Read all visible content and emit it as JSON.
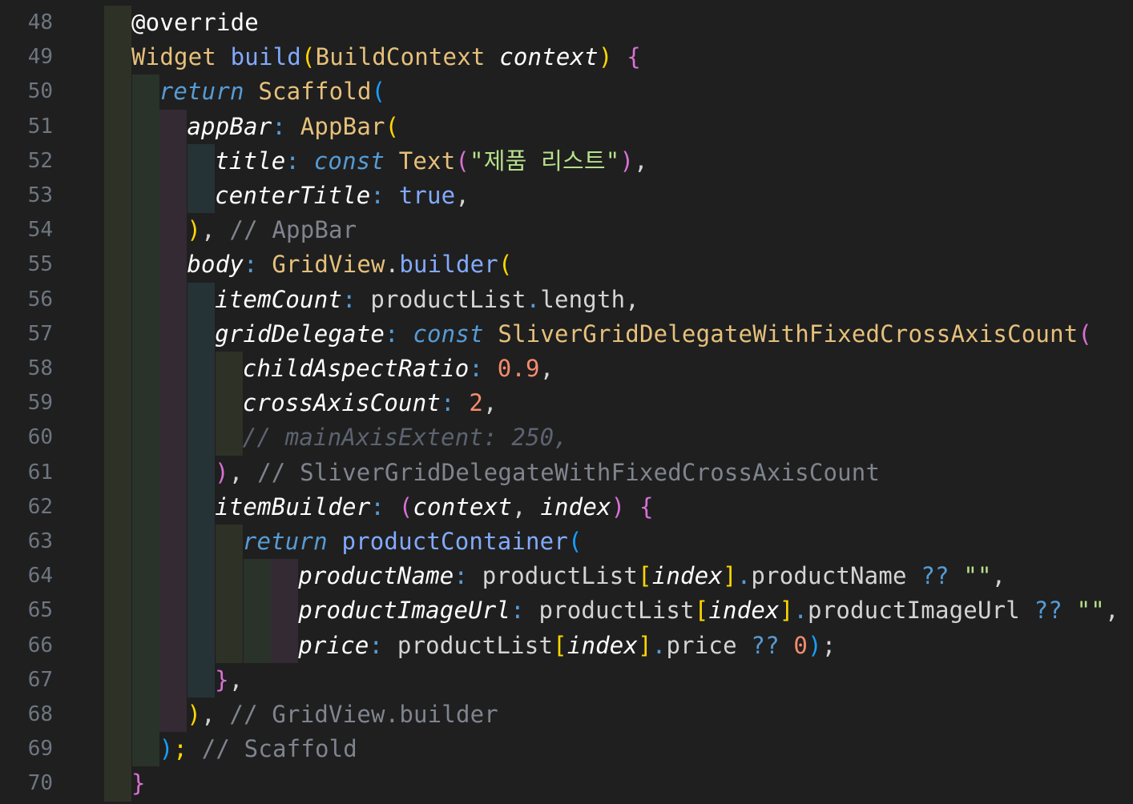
{
  "colors": {
    "background": "#1f1f1f",
    "line_number": "#6e7681",
    "default": "#d4d4d4",
    "keyword_ctrl": "#569cd6",
    "type": "#e6c07b",
    "function": "#82aaff",
    "param": "#ffffff",
    "string": "#b5e08a",
    "number": "#f78c6c",
    "comment": "#7f848e",
    "bracket_yellow": "#ffd700",
    "bracket_pink": "#da70d6",
    "bracket_blue": "#179fff",
    "decorator": "#ffffff"
  },
  "lines": [
    {
      "num": "48",
      "tokens": [
        {
          "t": "@override",
          "c": "decorator"
        }
      ]
    },
    {
      "num": "49",
      "tokens": [
        {
          "t": "Widget",
          "c": "type"
        },
        {
          "t": " "
        },
        {
          "t": "build",
          "c": "function"
        },
        {
          "t": "(",
          "c": "bracket_yellow"
        },
        {
          "t": "BuildContext",
          "c": "type"
        },
        {
          "t": " "
        },
        {
          "t": "context",
          "c": "param",
          "i": true
        },
        {
          "t": ")",
          "c": "bracket_yellow"
        },
        {
          "t": " "
        },
        {
          "t": "{",
          "c": "bracket_pink"
        }
      ]
    },
    {
      "num": "50",
      "tokens": [
        {
          "t": "return",
          "c": "keyword_ctrl",
          "i": true
        },
        {
          "t": " "
        },
        {
          "t": "Scaffold",
          "c": "type"
        },
        {
          "t": "(",
          "c": "bracket_blue"
        }
      ]
    },
    {
      "num": "51",
      "tokens": [
        {
          "t": "appBar",
          "c": "param",
          "i": true
        },
        {
          "t": ":",
          "c": "keyword_ctrl"
        },
        {
          "t": " "
        },
        {
          "t": "AppBar",
          "c": "type"
        },
        {
          "t": "(",
          "c": "bracket_yellow"
        }
      ]
    },
    {
      "num": "52",
      "tokens": [
        {
          "t": "title",
          "c": "param",
          "i": true
        },
        {
          "t": ":",
          "c": "keyword_ctrl"
        },
        {
          "t": " "
        },
        {
          "t": "const",
          "c": "keyword_ctrl",
          "i": true
        },
        {
          "t": " "
        },
        {
          "t": "Text",
          "c": "type"
        },
        {
          "t": "(",
          "c": "bracket_pink"
        },
        {
          "t": "\"제품 리스트\"",
          "c": "string"
        },
        {
          "t": ")",
          "c": "bracket_pink"
        },
        {
          "t": ",",
          "c": "default"
        }
      ]
    },
    {
      "num": "53",
      "tokens": [
        {
          "t": "centerTitle",
          "c": "param",
          "i": true
        },
        {
          "t": ":",
          "c": "keyword_ctrl"
        },
        {
          "t": " "
        },
        {
          "t": "true",
          "c": "function"
        },
        {
          "t": ",",
          "c": "default"
        }
      ]
    },
    {
      "num": "54",
      "tokens": [
        {
          "t": ")",
          "c": "bracket_yellow"
        },
        {
          "t": ",",
          "c": "default"
        },
        {
          "t": " "
        },
        {
          "t": "// AppBar",
          "c": "comment"
        }
      ]
    },
    {
      "num": "55",
      "tokens": [
        {
          "t": "body",
          "c": "param",
          "i": true
        },
        {
          "t": ":",
          "c": "keyword_ctrl"
        },
        {
          "t": " "
        },
        {
          "t": "GridView",
          "c": "type"
        },
        {
          "t": ".",
          "c": "default"
        },
        {
          "t": "builder",
          "c": "function"
        },
        {
          "t": "(",
          "c": "bracket_yellow"
        }
      ]
    },
    {
      "num": "56",
      "tokens": [
        {
          "t": "itemCount",
          "c": "param",
          "i": true
        },
        {
          "t": ":",
          "c": "keyword_ctrl"
        },
        {
          "t": " "
        },
        {
          "t": "productList",
          "c": "default"
        },
        {
          "t": ".",
          "c": "keyword_ctrl"
        },
        {
          "t": "length",
          "c": "default"
        },
        {
          "t": ",",
          "c": "default"
        }
      ]
    },
    {
      "num": "57",
      "tokens": [
        {
          "t": "gridDelegate",
          "c": "param",
          "i": true
        },
        {
          "t": ":",
          "c": "keyword_ctrl"
        },
        {
          "t": " "
        },
        {
          "t": "const",
          "c": "keyword_ctrl",
          "i": true
        },
        {
          "t": " "
        },
        {
          "t": "SliverGridDelegateWithFixedCrossAxisCount",
          "c": "type"
        },
        {
          "t": "(",
          "c": "bracket_pink"
        }
      ]
    },
    {
      "num": "58",
      "tokens": [
        {
          "t": "childAspectRatio",
          "c": "param",
          "i": true
        },
        {
          "t": ":",
          "c": "keyword_ctrl"
        },
        {
          "t": " "
        },
        {
          "t": "0.9",
          "c": "number"
        },
        {
          "t": ",",
          "c": "default"
        }
      ]
    },
    {
      "num": "59",
      "tokens": [
        {
          "t": "crossAxisCount",
          "c": "param",
          "i": true
        },
        {
          "t": ":",
          "c": "keyword_ctrl"
        },
        {
          "t": " "
        },
        {
          "t": "2",
          "c": "number"
        },
        {
          "t": ",",
          "c": "default"
        }
      ]
    },
    {
      "num": "60",
      "tokens": [
        {
          "t": "// mainAxisExtent: 250,",
          "c": "comment_dim",
          "i": true
        }
      ]
    },
    {
      "num": "61",
      "tokens": [
        {
          "t": ")",
          "c": "bracket_pink"
        },
        {
          "t": ",",
          "c": "default"
        },
        {
          "t": " "
        },
        {
          "t": "// SliverGridDelegateWithFixedCrossAxisCount",
          "c": "comment"
        }
      ]
    },
    {
      "num": "62",
      "tokens": [
        {
          "t": "itemBuilder",
          "c": "param",
          "i": true
        },
        {
          "t": ":",
          "c": "keyword_ctrl"
        },
        {
          "t": " "
        },
        {
          "t": "(",
          "c": "bracket_pink"
        },
        {
          "t": "context",
          "c": "param",
          "i": true
        },
        {
          "t": ",",
          "c": "default"
        },
        {
          "t": " "
        },
        {
          "t": "index",
          "c": "param",
          "i": true
        },
        {
          "t": ")",
          "c": "bracket_pink"
        },
        {
          "t": " "
        },
        {
          "t": "{",
          "c": "bracket_pink"
        }
      ]
    },
    {
      "num": "63",
      "tokens": [
        {
          "t": "return",
          "c": "keyword_ctrl",
          "i": true
        },
        {
          "t": " "
        },
        {
          "t": "productContainer",
          "c": "function"
        },
        {
          "t": "(",
          "c": "bracket_blue"
        }
      ]
    },
    {
      "num": "64",
      "tokens": [
        {
          "t": "productName",
          "c": "param",
          "i": true
        },
        {
          "t": ":",
          "c": "keyword_ctrl"
        },
        {
          "t": " "
        },
        {
          "t": "productList",
          "c": "default"
        },
        {
          "t": "[",
          "c": "bracket_yellow"
        },
        {
          "t": "index",
          "c": "param",
          "i": true
        },
        {
          "t": "]",
          "c": "bracket_yellow"
        },
        {
          "t": ".",
          "c": "keyword_ctrl"
        },
        {
          "t": "productName",
          "c": "default"
        },
        {
          "t": " "
        },
        {
          "t": "??",
          "c": "keyword_ctrl"
        },
        {
          "t": " "
        },
        {
          "t": "\"\"",
          "c": "string"
        },
        {
          "t": ",",
          "c": "default"
        }
      ]
    },
    {
      "num": "65",
      "tokens": [
        {
          "t": "productImageUrl",
          "c": "param",
          "i": true
        },
        {
          "t": ":",
          "c": "keyword_ctrl"
        },
        {
          "t": " "
        },
        {
          "t": "productList",
          "c": "default"
        },
        {
          "t": "[",
          "c": "bracket_yellow"
        },
        {
          "t": "index",
          "c": "param",
          "i": true
        },
        {
          "t": "]",
          "c": "bracket_yellow"
        },
        {
          "t": ".",
          "c": "keyword_ctrl"
        },
        {
          "t": "productImageUrl",
          "c": "default"
        },
        {
          "t": " "
        },
        {
          "t": "??",
          "c": "keyword_ctrl"
        },
        {
          "t": " "
        },
        {
          "t": "\"\"",
          "c": "string"
        },
        {
          "t": ",",
          "c": "default"
        }
      ]
    },
    {
      "num": "66",
      "tokens": [
        {
          "t": "price",
          "c": "param",
          "i": true
        },
        {
          "t": ":",
          "c": "keyword_ctrl"
        },
        {
          "t": " "
        },
        {
          "t": "productList",
          "c": "default"
        },
        {
          "t": "[",
          "c": "bracket_yellow"
        },
        {
          "t": "index",
          "c": "param",
          "i": true
        },
        {
          "t": "]",
          "c": "bracket_yellow"
        },
        {
          "t": ".",
          "c": "keyword_ctrl"
        },
        {
          "t": "price",
          "c": "default"
        },
        {
          "t": " "
        },
        {
          "t": "??",
          "c": "keyword_ctrl"
        },
        {
          "t": " "
        },
        {
          "t": "0",
          "c": "number"
        },
        {
          "t": ")",
          "c": "bracket_blue"
        },
        {
          "t": ";",
          "c": "default"
        }
      ]
    },
    {
      "num": "67",
      "tokens": [
        {
          "t": "}",
          "c": "bracket_pink"
        },
        {
          "t": ",",
          "c": "default"
        }
      ]
    },
    {
      "num": "68",
      "tokens": [
        {
          "t": ")",
          "c": "bracket_yellow"
        },
        {
          "t": ",",
          "c": "default"
        },
        {
          "t": " "
        },
        {
          "t": "// GridView.builder",
          "c": "comment"
        }
      ]
    },
    {
      "num": "69",
      "tokens": [
        {
          "t": ")",
          "c": "bracket_blue"
        },
        {
          "t": ";",
          "c": "bracket_yellow"
        },
        {
          "t": " "
        },
        {
          "t": "// Scaffold",
          "c": "comment"
        }
      ]
    },
    {
      "num": "70",
      "tokens": [
        {
          "t": "}",
          "c": "bracket_pink"
        }
      ]
    }
  ]
}
